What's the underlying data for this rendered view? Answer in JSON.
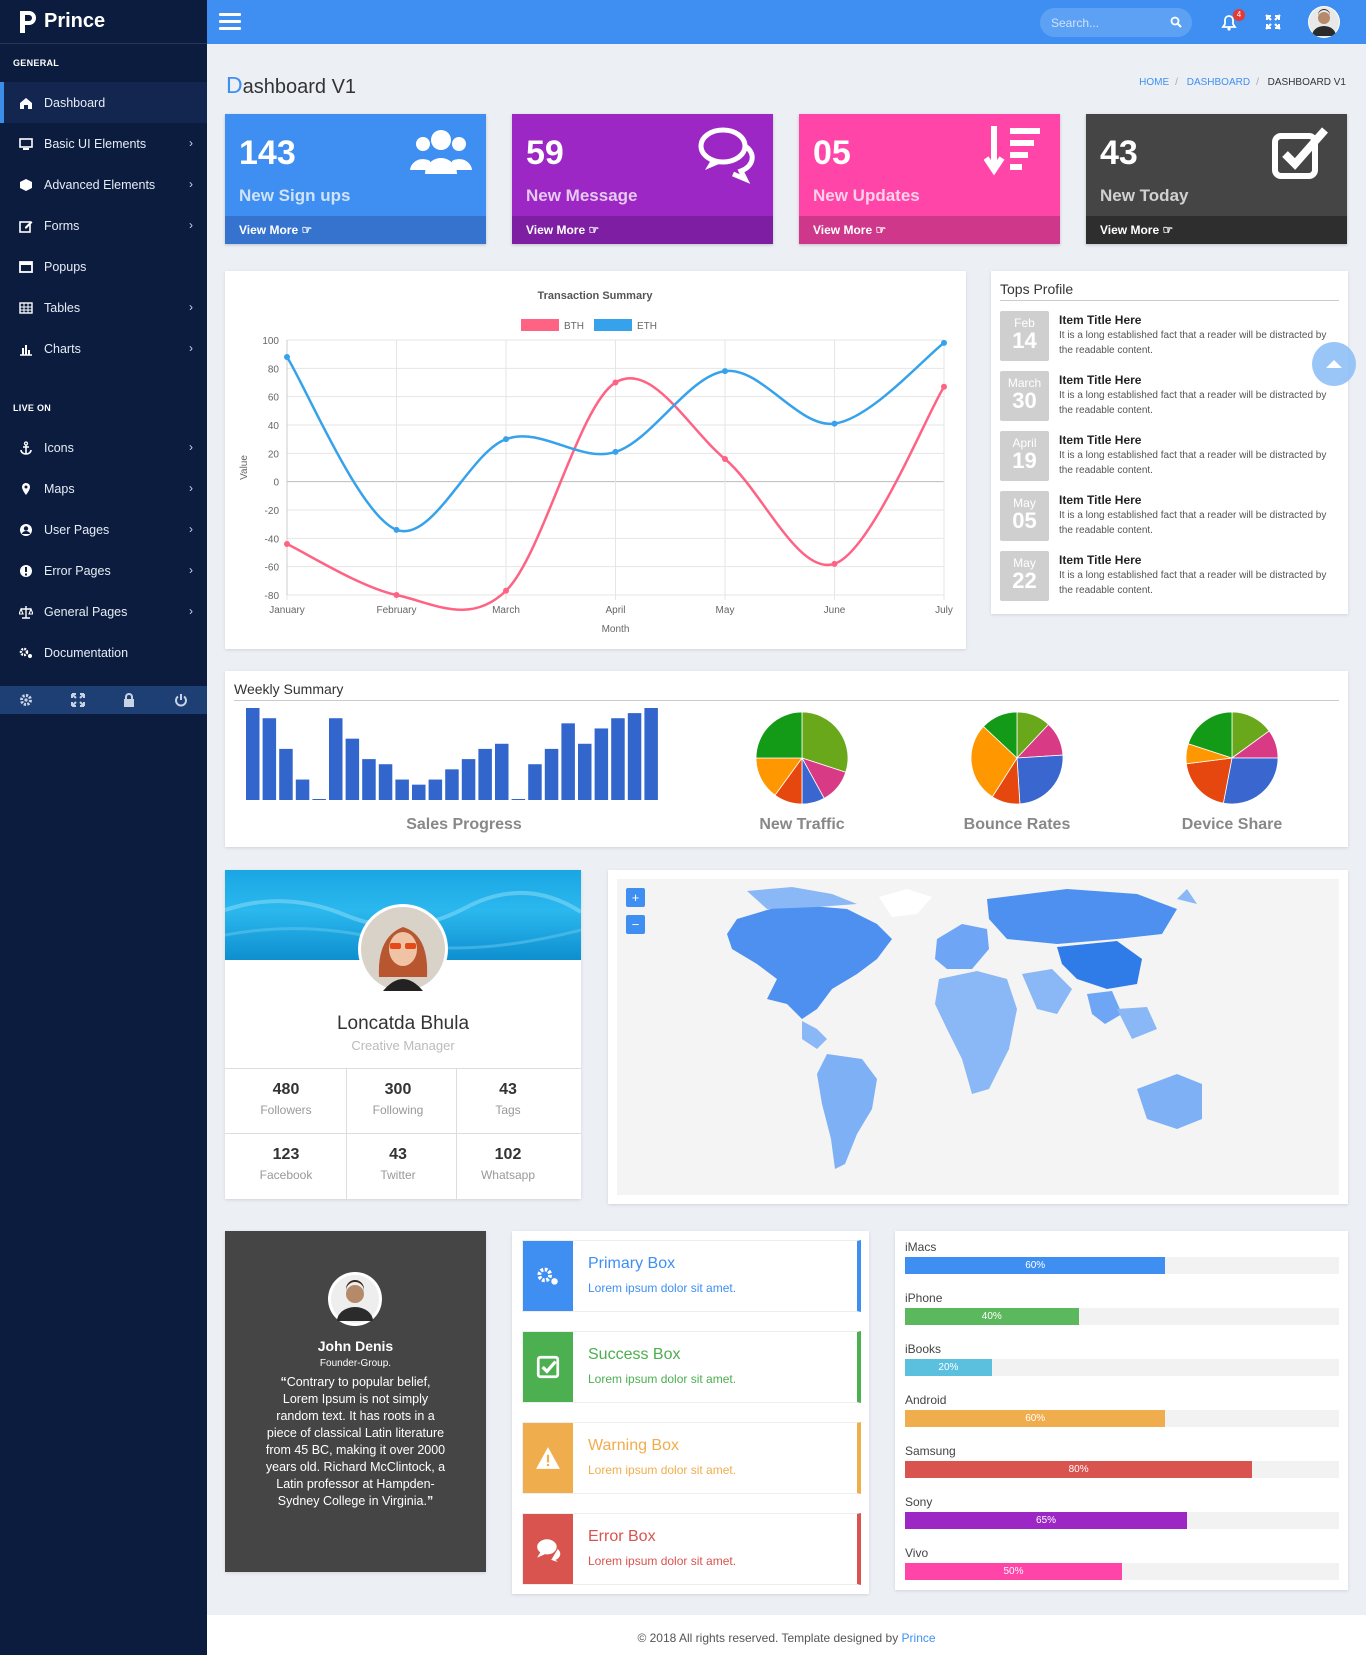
{
  "app": {
    "name": "Prince"
  },
  "sidebar": {
    "section_general": "GENERAL",
    "section_live": "LIVE ON",
    "general_items": [
      {
        "label": "Dashboard",
        "icon": "home-icon",
        "active": true
      },
      {
        "label": "Basic UI Elements",
        "icon": "monitor-icon"
      },
      {
        "label": "Advanced Elements",
        "icon": "cube-icon"
      },
      {
        "label": "Forms",
        "icon": "edit-icon"
      },
      {
        "label": "Popups",
        "icon": "window-icon"
      },
      {
        "label": "Tables",
        "icon": "table-icon"
      },
      {
        "label": "Charts",
        "icon": "bar-chart-icon"
      }
    ],
    "live_items": [
      {
        "label": "Icons",
        "icon": "anchor-icon"
      },
      {
        "label": "Maps",
        "icon": "map-marker-icon"
      },
      {
        "label": "User Pages",
        "icon": "user-circle-icon"
      },
      {
        "label": "Error Pages",
        "icon": "exclamation-icon"
      },
      {
        "label": "General Pages",
        "icon": "balance-scale-icon"
      },
      {
        "label": "Documentation",
        "icon": "cogs-icon"
      }
    ],
    "footer_icons": [
      "settings-icon",
      "fullscreen-icon",
      "lock-icon",
      "power-icon"
    ]
  },
  "topbar": {
    "search_placeholder": "Search...",
    "notification_count": "4"
  },
  "page": {
    "title_first": "D",
    "title_rest": "ashboard V1"
  },
  "breadcrumb": [
    "HOME",
    "DASHBOARD",
    "DASHBOARD V1"
  ],
  "stats": [
    {
      "value": "143",
      "label": "New Sign ups",
      "more": "View More",
      "color": "#3f8ff2",
      "footer": "#3573cf",
      "icon": "users-icon"
    },
    {
      "value": "59",
      "label": "New Message",
      "more": "View More",
      "color": "#9c27c5",
      "footer": "#7e1fa3",
      "icon": "comments-icon"
    },
    {
      "value": "05",
      "label": "New Updates",
      "more": "View More",
      "color": "#ff45a8",
      "footer": "#cf378a",
      "icon": "sort-amount-icon"
    },
    {
      "value": "43",
      "label": "New Today",
      "more": "View More",
      "color": "#454545",
      "footer": "#2e2e2e",
      "icon": "check-square-icon"
    }
  ],
  "chart_data": {
    "type": "line",
    "title": "Transaction Summary",
    "xlabel": "Month",
    "ylabel": "Value",
    "categories": [
      "January",
      "February",
      "March",
      "April",
      "May",
      "June",
      "July"
    ],
    "ylim": [
      -80,
      100
    ],
    "yticks": [
      100,
      80,
      60,
      40,
      20,
      0,
      -20,
      -40,
      -60,
      -80
    ],
    "legend": "top",
    "grid": true,
    "series": [
      {
        "name": "BTH",
        "color": "#ff6384",
        "values": [
          -44,
          -80,
          -77,
          70,
          16,
          -58,
          67
        ]
      },
      {
        "name": "ETH",
        "color": "#36a2eb",
        "values": [
          88,
          -34,
          30,
          21,
          78,
          41,
          98
        ]
      }
    ]
  },
  "tops_profile": {
    "title": "Tops Profile",
    "items": [
      {
        "month": "Feb",
        "day": "14",
        "title": "Item Title Here",
        "text": "It is a long established fact that a reader will be distracted by the readable content."
      },
      {
        "month": "March",
        "day": "30",
        "title": "Item Title Here",
        "text": "It is a long established fact that a reader will be distracted by the readable content."
      },
      {
        "month": "April",
        "day": "19",
        "title": "Item Title Here",
        "text": "It is a long established fact that a reader will be distracted by the readable content."
      },
      {
        "month": "May",
        "day": "05",
        "title": "Item Title Here",
        "text": "It is a long established fact that a reader will be distracted by the readable content."
      },
      {
        "month": "May",
        "day": "22",
        "title": "Item Title Here",
        "text": "It is a long established fact that a reader will be distracted by the readable content."
      }
    ]
  },
  "weekly": {
    "title": "Weekly Summary",
    "sales_label": "Sales Progress",
    "sales_values": [
      18,
      16,
      10,
      4,
      0,
      16,
      12,
      8,
      7,
      4,
      3,
      4,
      6,
      8,
      10,
      11,
      0,
      7,
      10,
      15,
      11,
      14,
      16,
      17,
      18
    ],
    "pies": [
      {
        "label": "New Traffic",
        "slices": [
          {
            "v": 30,
            "c": "#6aa81b"
          },
          {
            "v": 12,
            "c": "#d93a86"
          },
          {
            "v": 8,
            "c": "#3a66cf"
          },
          {
            "v": 10,
            "c": "#e6470f"
          },
          {
            "v": 15,
            "c": "#ff9800"
          },
          {
            "v": 25,
            "c": "#139a16"
          }
        ]
      },
      {
        "label": "Bounce Rates",
        "slices": [
          {
            "v": 12,
            "c": "#6aa81b"
          },
          {
            "v": 12,
            "c": "#d93a86"
          },
          {
            "v": 25,
            "c": "#3a66cf"
          },
          {
            "v": 10,
            "c": "#e6470f"
          },
          {
            "v": 28,
            "c": "#ff9800"
          },
          {
            "v": 13,
            "c": "#139a16"
          }
        ]
      },
      {
        "label": "Device Share",
        "slices": [
          {
            "v": 15,
            "c": "#6aa81b"
          },
          {
            "v": 10,
            "c": "#d93a86"
          },
          {
            "v": 28,
            "c": "#3a66cf"
          },
          {
            "v": 20,
            "c": "#e6470f"
          },
          {
            "v": 7,
            "c": "#ff9800"
          },
          {
            "v": 20,
            "c": "#139a16"
          }
        ]
      }
    ]
  },
  "profile": {
    "name": "Loncatda Bhula",
    "role": "Creative Manager",
    "stats": [
      {
        "value": "480",
        "label": "Followers"
      },
      {
        "value": "300",
        "label": "Following"
      },
      {
        "value": "43",
        "label": "Tags"
      },
      {
        "value": "123",
        "label": "Facebook"
      },
      {
        "value": "43",
        "label": "Twitter"
      },
      {
        "value": "102",
        "label": "Whatsapp"
      }
    ]
  },
  "map": {
    "zoom_in": "+",
    "zoom_out": "−"
  },
  "testimonial": {
    "name": "John Denis",
    "role": "Founder-Group.",
    "quote": "Contrary to popular belief, Lorem Ipsum is not simply random text. It has roots in a piece of classical Latin literature from 45 BC, making it over 2000 years old. Richard McClintock, a Latin professor at Hampden-Sydney College in Virginia."
  },
  "boxes": [
    {
      "title": "Primary Box",
      "text": "Lorem ipsum dolor sit amet.",
      "color": "#3f8ff2",
      "icon": "cogs-icon"
    },
    {
      "title": "Success Box",
      "text": "Lorem ipsum dolor sit amet.",
      "color": "#4caf50",
      "icon": "check-square-icon"
    },
    {
      "title": "Warning Box",
      "text": "Lorem ipsum dolor sit amet.",
      "color": "#f0ad4e",
      "icon": "warning-icon"
    },
    {
      "title": "Error Box",
      "text": "Lorem ipsum dolor sit amet.",
      "color": "#d9534f",
      "icon": "comments-icon"
    }
  ],
  "progress": [
    {
      "label": "iMacs",
      "pct": 60,
      "text": "60%",
      "color": "#3f8ff2"
    },
    {
      "label": "iPhone",
      "pct": 40,
      "text": "40%",
      "color": "#5cb85c"
    },
    {
      "label": "iBooks",
      "pct": 20,
      "text": "20%",
      "color": "#5bc0de"
    },
    {
      "label": "Android",
      "pct": 60,
      "text": "60%",
      "color": "#f0ad4e"
    },
    {
      "label": "Samsung",
      "pct": 80,
      "text": "80%",
      "color": "#d9534f"
    },
    {
      "label": "Sony",
      "pct": 65,
      "text": "65%",
      "color": "#9c27c5"
    },
    {
      "label": "Vivo",
      "pct": 50,
      "text": "50%",
      "color": "#ff45a8"
    }
  ],
  "footer": {
    "text": "© 2018 All rights reserved. Template designed by ",
    "brand": "Prince"
  }
}
